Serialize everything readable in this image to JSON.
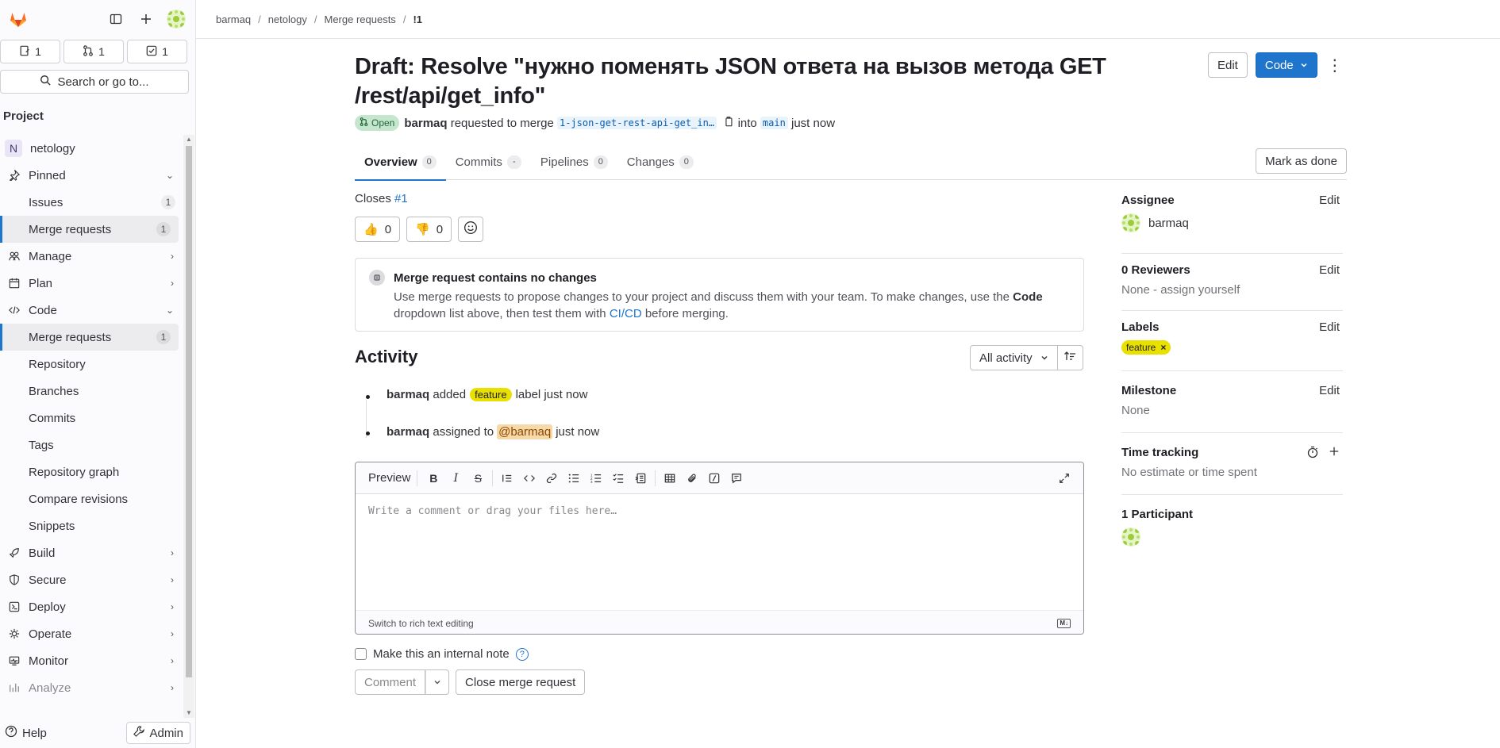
{
  "sidebar": {
    "counts": [
      {
        "icon": "issues-icon",
        "value": "1"
      },
      {
        "icon": "merge-request-icon",
        "value": "1"
      },
      {
        "icon": "todo-icon",
        "value": "1"
      }
    ],
    "search_label": "Search or go to...",
    "section_title": "Project",
    "project": {
      "initial": "N",
      "name": "netology"
    },
    "pinned": {
      "label": "Pinned"
    },
    "pinned_items": [
      {
        "label": "Issues",
        "count": "1"
      },
      {
        "label": "Merge requests",
        "count": "1"
      }
    ],
    "manage": "Manage",
    "plan": "Plan",
    "code": "Code",
    "code_items": [
      {
        "label": "Merge requests",
        "count": "1"
      },
      {
        "label": "Repository"
      },
      {
        "label": "Branches"
      },
      {
        "label": "Commits"
      },
      {
        "label": "Tags"
      },
      {
        "label": "Repository graph"
      },
      {
        "label": "Compare revisions"
      },
      {
        "label": "Snippets"
      }
    ],
    "build": "Build",
    "secure": "Secure",
    "deploy": "Deploy",
    "operate": "Operate",
    "monitor": "Monitor",
    "analyze": "Analyze",
    "help": "Help",
    "admin": "Admin"
  },
  "breadcrumb": [
    "barmaq",
    "netology",
    "Merge requests",
    "!1"
  ],
  "mr": {
    "title": "Draft: Resolve \"нужно поменять JSON ответа на вызов метода GET /rest/api/get_info\"",
    "edit_label": "Edit",
    "code_label": "Code",
    "status": "Open",
    "author": "barmaq",
    "requested_text": "requested to merge",
    "source_branch": "1-json-get-rest-api-get_in…",
    "into_text": "into",
    "target_branch": "main",
    "time": "just now"
  },
  "tabs": [
    {
      "label": "Overview",
      "count": "0"
    },
    {
      "label": "Commits",
      "count": "-"
    },
    {
      "label": "Pipelines",
      "count": "0"
    },
    {
      "label": "Changes",
      "count": "0"
    }
  ],
  "mark_done": "Mark as done",
  "closes": {
    "prefix": "Closes",
    "ref": "#1"
  },
  "reactions": {
    "thumbs_up": "0",
    "thumbs_down": "0"
  },
  "no_changes": {
    "title": "Merge request contains no changes",
    "body_1": "Use merge requests to propose changes to your project and discuss them with your team. To make changes, use the",
    "body_code": "Code",
    "body_2": "dropdown list above, then test them with",
    "body_link": "CI/CD",
    "body_3": "before merging."
  },
  "activity": {
    "heading": "Activity",
    "filter": "All activity",
    "items": [
      {
        "user": "barmaq",
        "pre": "added",
        "label": "feature",
        "post": "label just now"
      },
      {
        "user": "barmaq",
        "pre": "assigned to",
        "mention": "@barmaq",
        "post": "just now"
      }
    ]
  },
  "editor": {
    "preview": "Preview",
    "placeholder": "Write a comment or drag your files here…",
    "switch": "Switch to rich text editing"
  },
  "internal_note": "Make this an internal note",
  "comment_btn": "Comment",
  "close_btn": "Close merge request",
  "right": {
    "assignee_h": "Assignee",
    "assignee": "barmaq",
    "reviewers_h": "0 Reviewers",
    "reviewers_val": "None - assign yourself",
    "labels_h": "Labels",
    "label_chip": "feature",
    "milestone_h": "Milestone",
    "milestone_val": "None",
    "time_h": "Time tracking",
    "time_val": "No estimate or time spent",
    "participants_h": "1 Participant",
    "edit": "Edit"
  },
  "colors": {
    "accent": "#1f75cb",
    "label_feature": "#e9e000",
    "open_bg": "#c3e6cd"
  }
}
